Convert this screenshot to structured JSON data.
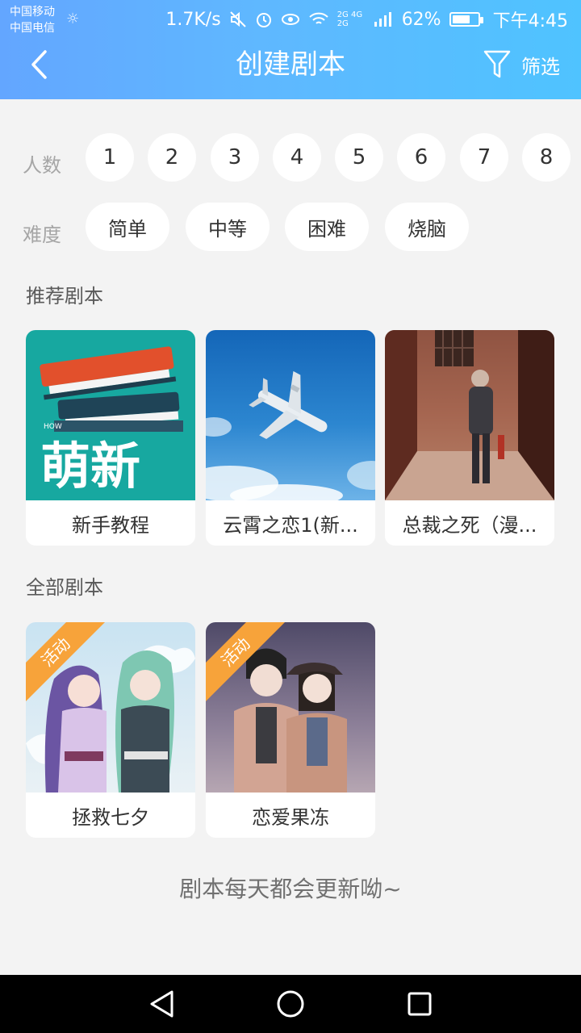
{
  "status_bar": {
    "carrier1": "中国移动",
    "carrier2": "中国电信",
    "speed": "1.7K/s",
    "signal_labels": "2G 4G 2G",
    "battery": "62%",
    "time": "下午4:45"
  },
  "header": {
    "title": "创建剧本",
    "filter_label": "筛选"
  },
  "filters": {
    "players_label": "人数",
    "players": [
      "1",
      "2",
      "3",
      "4",
      "5",
      "6",
      "7",
      "8"
    ],
    "difficulty_label": "难度",
    "difficulty": [
      "简单",
      "中等",
      "困难",
      "烧脑"
    ]
  },
  "recommended": {
    "title": "推荐剧本",
    "cards": [
      {
        "name": "新手教程",
        "thumb_text": "萌新",
        "thumb_small": "HOW"
      },
      {
        "name": "云霄之恋1(新..."
      },
      {
        "name": "总裁之死（漫..."
      }
    ]
  },
  "all_scripts": {
    "title": "全部剧本",
    "cards": [
      {
        "name": "拯救七夕",
        "badge": "活动"
      },
      {
        "name": "恋爱果冻",
        "badge": "活动"
      }
    ]
  },
  "footer_note": "剧本每天都会更新呦~",
  "colors": {
    "header_start": "#63a6ff",
    "header_end": "#4fc3ff",
    "badge": "#f7a33a",
    "background": "#f3f3f3"
  }
}
